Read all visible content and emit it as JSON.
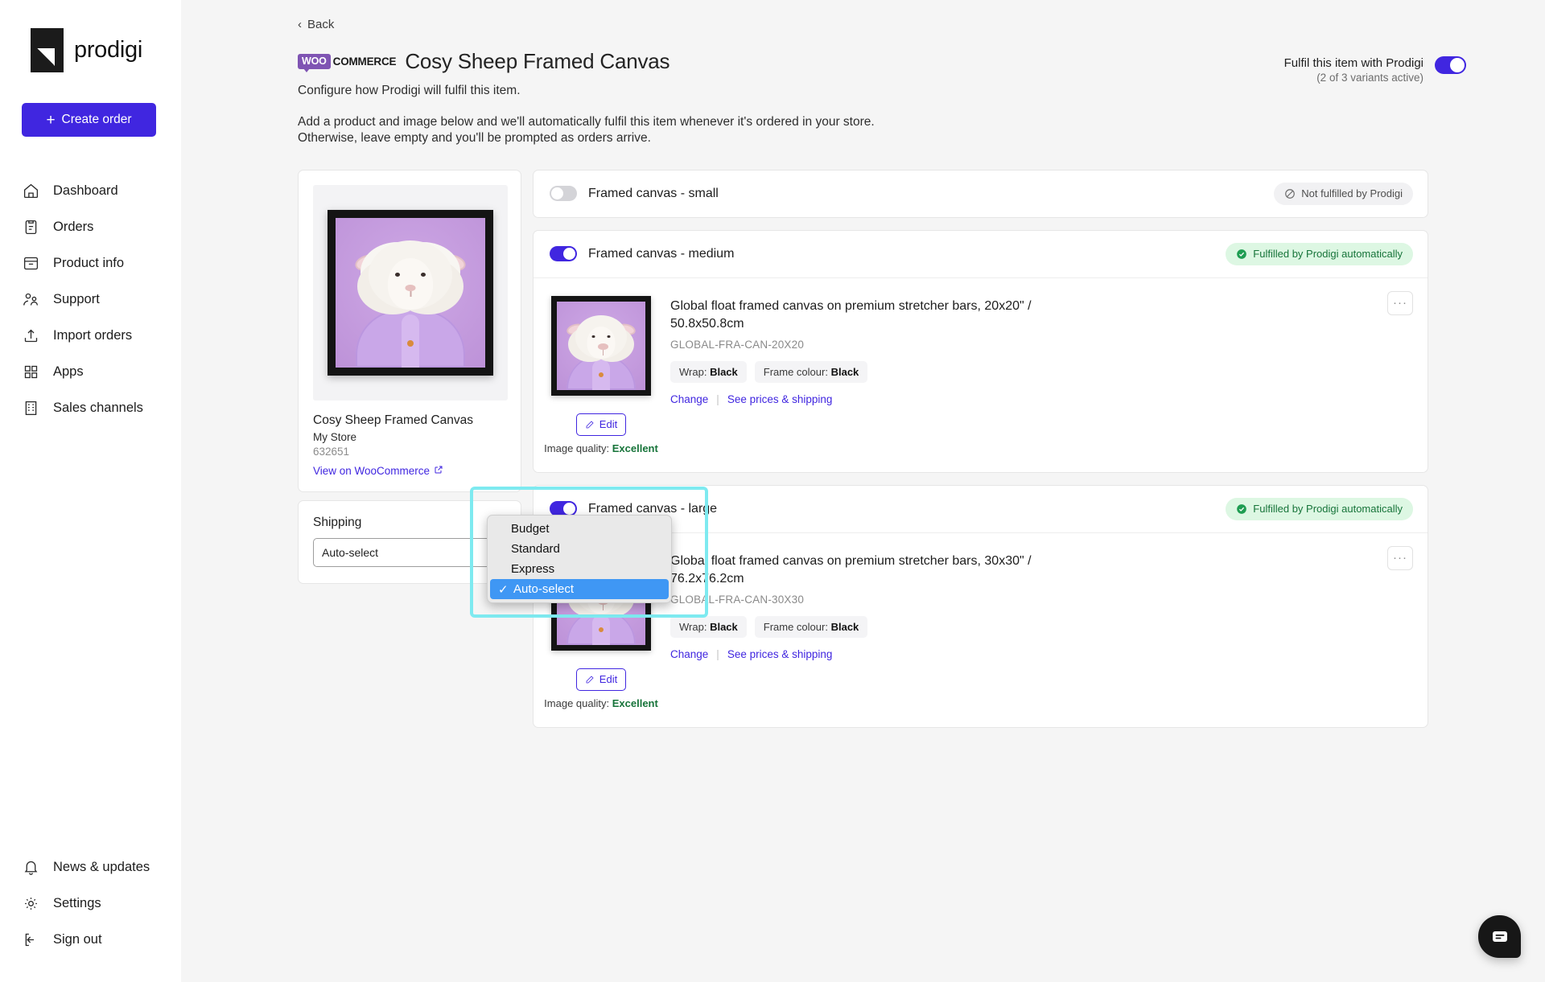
{
  "brand": {
    "name": "prodigi",
    "accent": "#4026e0"
  },
  "sidebar": {
    "create_order_label": "Create order",
    "items": [
      {
        "label": "Dashboard",
        "icon": "home-icon"
      },
      {
        "label": "Orders",
        "icon": "clipboard-icon"
      },
      {
        "label": "Product info",
        "icon": "archive-icon"
      },
      {
        "label": "Support",
        "icon": "people-icon"
      },
      {
        "label": "Import orders",
        "icon": "upload-icon"
      },
      {
        "label": "Apps",
        "icon": "grid-icon"
      },
      {
        "label": "Sales channels",
        "icon": "building-icon"
      }
    ],
    "bottom_items": [
      {
        "label": "News & updates",
        "icon": "bell-icon"
      },
      {
        "label": "Settings",
        "icon": "gear-icon"
      },
      {
        "label": "Sign out",
        "icon": "sign-out-icon"
      }
    ]
  },
  "header": {
    "back_label": "Back",
    "channel_badge_a": "WOO",
    "channel_badge_b": "COMMERCE",
    "title": "Cosy Sheep Framed Canvas",
    "subtitle": "Configure how Prodigi will fulfil this item.",
    "description_line1": "Add a product and image below and we'll automatically fulfil this item whenever it's ordered in your store.",
    "description_line2": "Otherwise, leave empty and you'll be prompted as orders arrive.",
    "fulfil_toggle_label": "Fulfil this item with Prodigi",
    "fulfil_toggle_sub": "(2 of 3 variants active)",
    "fulfil_toggle_on": true
  },
  "preview": {
    "product_name": "Cosy Sheep Framed Canvas",
    "store": "My Store",
    "product_id": "632651",
    "view_link": "View on WooCommerce"
  },
  "shipping": {
    "label": "Shipping",
    "selected": "Auto-select",
    "options": [
      "Budget",
      "Standard",
      "Express",
      "Auto-select"
    ],
    "highlight_color": "#7eeaf0"
  },
  "variants": [
    {
      "name": "Framed canvas - small",
      "enabled": false,
      "status_label": "Not fulfilled by Prodigi",
      "status_type": "grey",
      "has_body": false
    },
    {
      "name": "Framed canvas - medium",
      "enabled": true,
      "status_label": "Fulfilled by Prodigi automatically",
      "status_type": "green",
      "has_body": true,
      "product_title": "Global float framed canvas on premium stretcher bars, 20x20\" / 50.8x50.8cm",
      "sku": "GLOBAL-FRA-CAN-20X20",
      "attributes": [
        {
          "label": "Wrap:",
          "value": "Black"
        },
        {
          "label": "Frame colour:",
          "value": "Black"
        }
      ],
      "change_label": "Change",
      "prices_label": "See prices & shipping",
      "edit_label": "Edit",
      "image_quality_label": "Image quality:",
      "image_quality_value": "Excellent",
      "kebab_label": "···"
    },
    {
      "name": "Framed canvas - large",
      "enabled": true,
      "status_label": "Fulfilled by Prodigi automatically",
      "status_type": "green",
      "has_body": true,
      "product_title": "Global float framed canvas on premium stretcher bars, 30x30\" / 76.2x76.2cm",
      "sku": "GLOBAL-FRA-CAN-30X30",
      "attributes": [
        {
          "label": "Wrap:",
          "value": "Black"
        },
        {
          "label": "Frame colour:",
          "value": "Black"
        }
      ],
      "change_label": "Change",
      "prices_label": "See prices & shipping",
      "edit_label": "Edit",
      "image_quality_label": "Image quality:",
      "image_quality_value": "Excellent",
      "kebab_label": "···"
    }
  ],
  "chat": {
    "icon": "chat-icon"
  }
}
